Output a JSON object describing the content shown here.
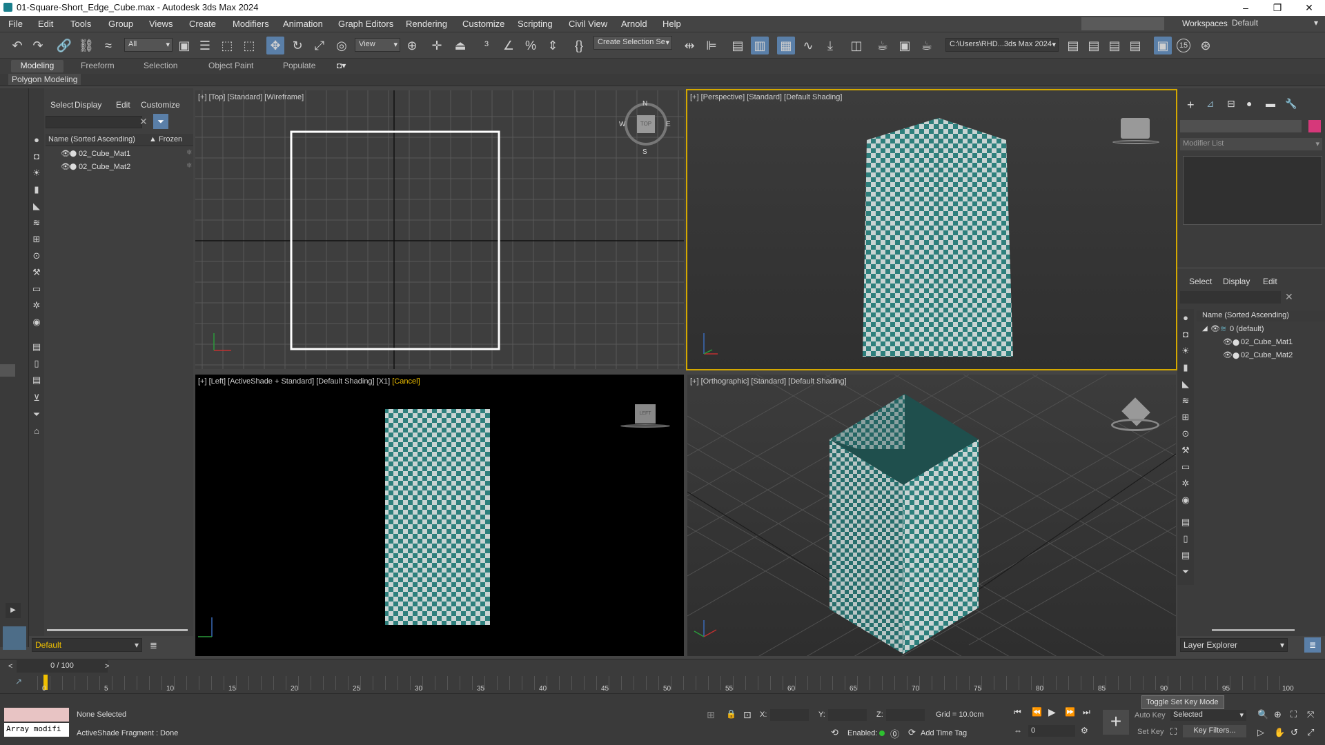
{
  "window": {
    "title": "01-Square-Short_Edge_Cube.max - Autodesk 3ds Max 2024"
  },
  "menu": [
    "File",
    "Edit",
    "Tools",
    "Group",
    "Views",
    "Create",
    "Modifiers",
    "Animation",
    "Graph Editors",
    "Rendering",
    "Customize",
    "Scripting",
    "Civil View",
    "Arnold",
    "Help"
  ],
  "workspaces": {
    "label": "Workspaces:",
    "value": "Default"
  },
  "toolbar": {
    "filter": "All",
    "refcoord": "View",
    "selection_set": "Create Selection Se",
    "path": "C:\\Users\\RHD...3ds Max 2024",
    "spinner_badge": "15"
  },
  "ribbon": {
    "tabs": [
      "Modeling",
      "Freeform",
      "Selection",
      "Object Paint",
      "Populate"
    ],
    "active": "Modeling",
    "sub": "Polygon Modeling"
  },
  "scene_explorer": {
    "tabs": [
      "Select",
      "Display",
      "Edit",
      "Customize"
    ],
    "col_name": "Name (Sorted Ascending)",
    "col_frozen": "▲ Frozen",
    "items": [
      "02_Cube_Mat1",
      "02_Cube_Mat2"
    ],
    "bottom_combo": "Default"
  },
  "viewports": {
    "top": {
      "label": "[+] [Top] [Standard] [Wireframe]",
      "compass": [
        "N",
        "E",
        "S",
        "W"
      ],
      "cube_label": "TOP"
    },
    "perspective": {
      "label": "[+] [Perspective] [Standard] [Default Shading]"
    },
    "left": {
      "label": "[+] [Left] [ActiveShade + Standard] [Default Shading] [X1]",
      "cancel": "[Cancel]",
      "cube_label": "LEFT"
    },
    "ortho": {
      "label": "[+] [Orthographic] [Standard] [Default Shading]"
    }
  },
  "command_panel": {
    "modifier_list": "Modifier List",
    "tabs": [
      "Select",
      "Display",
      "Edit"
    ],
    "col_name": "Name (Sorted Ascending)",
    "layer": "0 (default)",
    "items": [
      "02_Cube_Mat1",
      "02_Cube_Mat2"
    ],
    "footer": "Layer Explorer",
    "swatch_color": "#d6387a"
  },
  "timeline": {
    "frame": "0 / 100",
    "ticks": [
      "0",
      "5",
      "10",
      "15",
      "20",
      "25",
      "30",
      "35",
      "40",
      "45",
      "50",
      "55",
      "60",
      "65",
      "70",
      "75",
      "80",
      "85",
      "90",
      "95",
      "100"
    ]
  },
  "status": {
    "script_listener": "Array modifi",
    "selection": "None Selected",
    "prompt": "ActiveShade Fragment : Done",
    "x_label": "X:",
    "y_label": "Y:",
    "z_label": "Z:",
    "grid": "Grid = 10.0cm",
    "enabled": "Enabled:",
    "add_time_tag": "Add Time Tag",
    "auto_key": "Auto Key",
    "set_key": "Set Key",
    "key_mode": "Selected",
    "key_filters": "Key Filters...",
    "frame_input": "0",
    "tooltip": "Toggle Set Key Mode"
  },
  "colors": {
    "teal": "#2e7f7c",
    "tile_light": "#c9d4d3",
    "accent_yellow": "#f0c000"
  }
}
